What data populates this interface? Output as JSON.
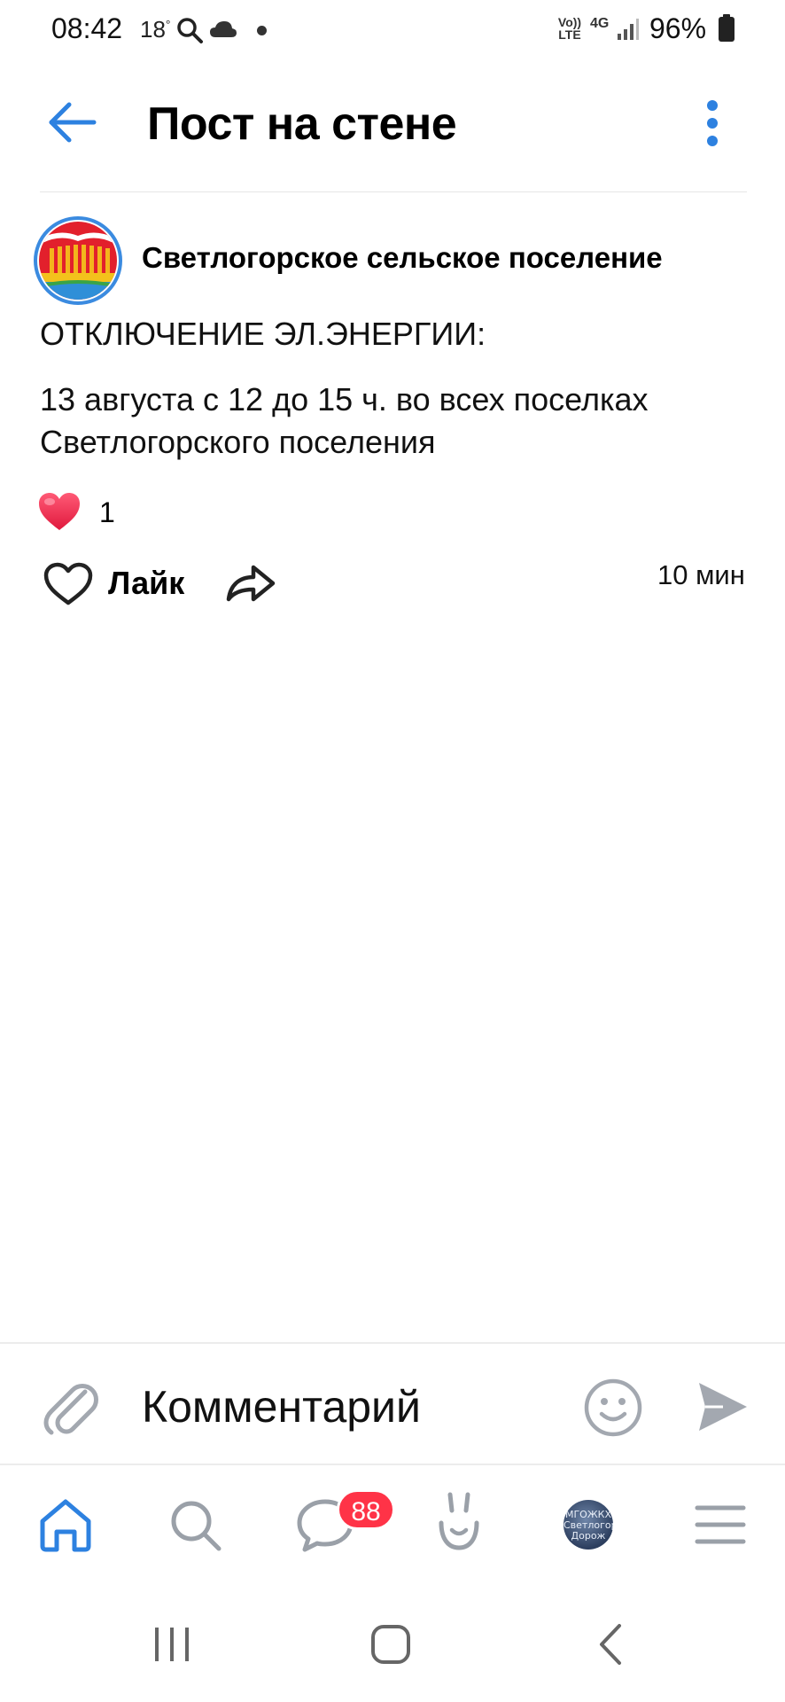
{
  "status_bar": {
    "time": "08:42",
    "temperature": "18",
    "temperature_unit": "°",
    "network_labels": [
      "Vo)) LTE",
      "4G"
    ],
    "battery": "96%"
  },
  "header": {
    "title": "Пост на стене",
    "back_icon": "arrow-left-icon",
    "menu_icon": "more-vertical-icon"
  },
  "post": {
    "author": "Светлогорское сельское поселение",
    "heading": "ОТКЛЮЧЕНИЕ ЭЛ.ЭНЕРГИИ:",
    "body": "13 августа с 12 до 15 ч. во всех поселках Светлогорского поселения",
    "reaction_count": "1",
    "like_label": "Лайк",
    "time": "10 мин"
  },
  "comment": {
    "placeholder": "Комментарий"
  },
  "tabbar": {
    "badge": "88",
    "avatar_text": [
      "МГОЖКХ",
      "Светлогор",
      "Дорож"
    ]
  },
  "colors": {
    "accent": "#2d81e0",
    "badge": "#ff3347",
    "heart": "#f23a57",
    "icon_gray": "#9aa0a8"
  }
}
